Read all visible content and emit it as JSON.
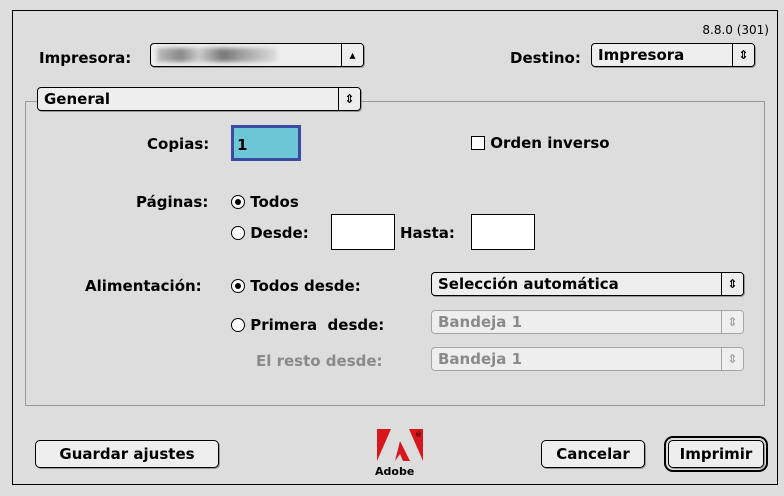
{
  "version": "8.8.0 (301)",
  "printer": {
    "label": "Impresora:",
    "value": ""
  },
  "destination": {
    "label": "Destino:",
    "value": "Impresora"
  },
  "panel": {
    "value": "General"
  },
  "copies": {
    "label": "Copias:",
    "value": "1"
  },
  "reverse_order": {
    "label": "Orden inverso",
    "checked": false
  },
  "pages": {
    "label": "Páginas:",
    "all_label": "Todos",
    "from_label": "Desde:",
    "to_label": "Hasta:",
    "from_value": "",
    "to_value": "",
    "selected": "all"
  },
  "paper_source": {
    "label": "Alimentación:",
    "all_from_label": "Todos desde:",
    "all_from_value": "Selección automática",
    "first_from_label": "Primera  desde:",
    "first_from_value": "Bandeja 1",
    "rest_from_label": "El resto desde:",
    "rest_from_value": "Bandeja 1",
    "selected": "all"
  },
  "buttons": {
    "save": "Guardar ajustes",
    "cancel": "Cancelar",
    "print": "Imprimir"
  },
  "logo": {
    "text": "Adobe"
  },
  "icons": {
    "popup_arrows": "up-down-arrows-icon",
    "logo": "adobe-logo-icon"
  }
}
